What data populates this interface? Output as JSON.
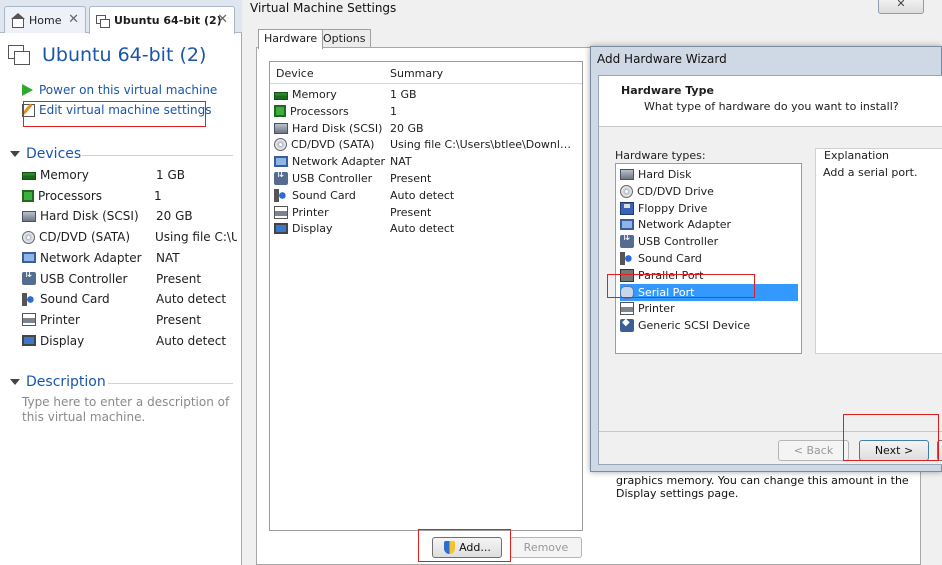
{
  "workstation": {
    "tabs": [
      {
        "label": "Home",
        "icon": "home-icon"
      },
      {
        "label": "Ubuntu 64-bit (2)",
        "icon": "vm-icon"
      }
    ],
    "vm_title": "Ubuntu 64-bit (2)",
    "actions": {
      "power_on": "Power on this virtual machine",
      "edit_settings": "Edit virtual machine settings"
    },
    "devices_heading": "Devices",
    "devices": [
      {
        "name": "Memory",
        "value": "1 GB",
        "icon": "memory-icon"
      },
      {
        "name": "Processors",
        "value": "1",
        "icon": "processor-icon"
      },
      {
        "name": "Hard Disk (SCSI)",
        "value": "20 GB",
        "icon": "hard-disk-icon"
      },
      {
        "name": "CD/DVD (SATA)",
        "value": "Using file C:\\Us...",
        "icon": "cd-dvd-icon"
      },
      {
        "name": "Network Adapter",
        "value": "NAT",
        "icon": "network-adapter-icon"
      },
      {
        "name": "USB Controller",
        "value": "Present",
        "icon": "usb-icon"
      },
      {
        "name": "Sound Card",
        "value": "Auto detect",
        "icon": "sound-card-icon"
      },
      {
        "name": "Printer",
        "value": "Present",
        "icon": "printer-icon"
      },
      {
        "name": "Display",
        "value": "Auto detect",
        "icon": "display-icon"
      }
    ],
    "description_heading": "Description",
    "description_placeholder": "Type here to enter a description of this virtual machine."
  },
  "settings_dialog": {
    "title": "Virtual Machine Settings",
    "close_label": "✕",
    "tabs": [
      "Hardware",
      "Options"
    ],
    "columns": {
      "device": "Device",
      "summary": "Summary"
    },
    "hardware": [
      {
        "name": "Memory",
        "summary": "1 GB",
        "icon": "memory-icon"
      },
      {
        "name": "Processors",
        "summary": "1",
        "icon": "processor-icon"
      },
      {
        "name": "Hard Disk (SCSI)",
        "summary": "20 GB",
        "icon": "hard-disk-icon"
      },
      {
        "name": "CD/DVD (SATA)",
        "summary": "Using file C:\\Users\\btlee\\Downlo...",
        "icon": "cd-dvd-icon"
      },
      {
        "name": "Network Adapter",
        "summary": "NAT",
        "icon": "network-adapter-icon"
      },
      {
        "name": "USB Controller",
        "summary": "Present",
        "icon": "usb-icon"
      },
      {
        "name": "Sound Card",
        "summary": "Auto detect",
        "icon": "sound-card-icon"
      },
      {
        "name": "Printer",
        "summary": "Present",
        "icon": "printer-icon"
      },
      {
        "name": "Display",
        "summary": "Auto detect",
        "icon": "display-icon"
      }
    ],
    "add_label": "Add...",
    "remove_label": "Remove",
    "background_description": "graphics memory. You can change this amount in the Display settings page."
  },
  "wizard": {
    "title": "Add Hardware Wizard",
    "heading": "Hardware Type",
    "subheading": "What type of hardware do you want to install?",
    "types_label": "Hardware types:",
    "types": [
      {
        "name": "Hard Disk",
        "icon": "hard-disk-icon"
      },
      {
        "name": "CD/DVD Drive",
        "icon": "cd-dvd-icon"
      },
      {
        "name": "Floppy Drive",
        "icon": "floppy-icon"
      },
      {
        "name": "Network Adapter",
        "icon": "network-adapter-icon"
      },
      {
        "name": "USB Controller",
        "icon": "usb-icon"
      },
      {
        "name": "Sound Card",
        "icon": "sound-card-icon"
      },
      {
        "name": "Parallel Port",
        "icon": "parallel-port-icon"
      },
      {
        "name": "Serial Port",
        "icon": "serial-port-icon"
      },
      {
        "name": "Printer",
        "icon": "printer-icon"
      },
      {
        "name": "Generic SCSI Device",
        "icon": "scsi-icon"
      }
    ],
    "selected_type": "Serial Port",
    "explanation_label": "Explanation",
    "explanation_text": "Add a serial port.",
    "back_label": "< Back",
    "next_label": "Next >"
  },
  "colors": {
    "accent": "#1a56a8",
    "selection": "#3399ff",
    "highlight": "#e02020"
  }
}
